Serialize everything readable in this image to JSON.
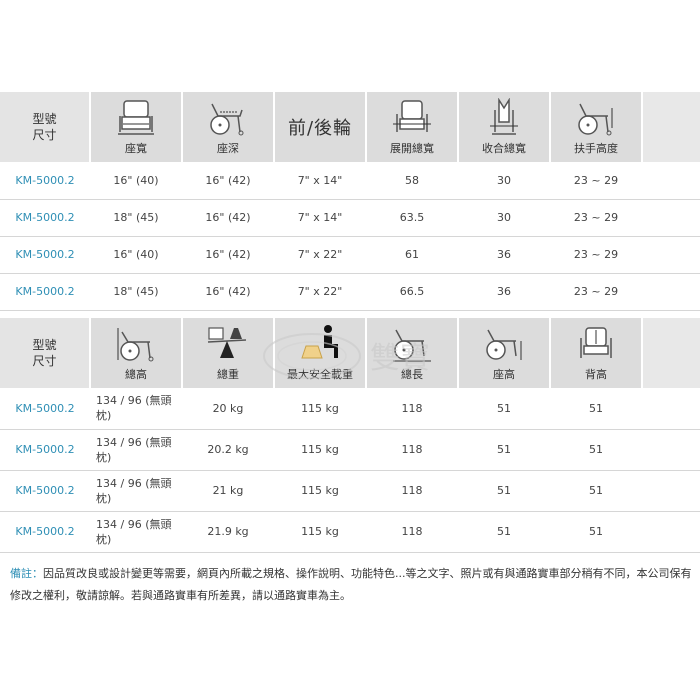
{
  "table1": {
    "model_header": [
      "型號",
      "尺寸"
    ],
    "columns": [
      "座寬",
      "座深",
      "前/後輪",
      "展開總寬",
      "收合總寬",
      "扶手高度"
    ],
    "rows": [
      {
        "model": "KM-5000.2",
        "cells": [
          "16\" (40)",
          "16\" (42)",
          "7\" x 14\"",
          "58",
          "30",
          "23 ~ 29"
        ]
      },
      {
        "model": "KM-5000.2",
        "cells": [
          "18\" (45)",
          "16\" (42)",
          "7\" x 14\"",
          "63.5",
          "30",
          "23 ~ 29"
        ]
      },
      {
        "model": "KM-5000.2",
        "cells": [
          "16\" (40)",
          "16\" (42)",
          "7\" x 22\"",
          "61",
          "36",
          "23 ~ 29"
        ]
      },
      {
        "model": "KM-5000.2",
        "cells": [
          "18\" (45)",
          "16\" (42)",
          "7\" x 22\"",
          "66.5",
          "36",
          "23 ~ 29"
        ]
      }
    ]
  },
  "table2": {
    "model_header": [
      "型號",
      "尺寸"
    ],
    "columns": [
      "總高",
      "總重",
      "最大安全載重",
      "總長",
      "座高",
      "背高"
    ],
    "rows": [
      {
        "model": "KM-5000.2",
        "cells": [
          "134 / 96 (無頭枕)",
          "20 kg",
          "115 kg",
          "118",
          "51",
          "51"
        ]
      },
      {
        "model": "KM-5000.2",
        "cells": [
          "134 / 96 (無頭枕)",
          "20.2 kg",
          "115 kg",
          "118",
          "51",
          "51"
        ]
      },
      {
        "model": "KM-5000.2",
        "cells": [
          "134 / 96 (無頭枕)",
          "21 kg",
          "115 kg",
          "118",
          "51",
          "51"
        ]
      },
      {
        "model": "KM-5000.2",
        "cells": [
          "134 / 96 (無頭枕)",
          "21.9 kg",
          "115 kg",
          "118",
          "51",
          "51"
        ]
      }
    ]
  },
  "watermark_text": "雙寶",
  "note": {
    "label": "備註：",
    "text": "因品質改良或設計變更等需要，網頁內所載之規格、操作說明、功能特色...等之文字、照片或有與通路實車部分稍有不同，本公司保有修改之權利，敬請諒解。若與通路實車有所差異，請以通路實車為主。"
  },
  "colors": {
    "header_bg": "#dcdcdc",
    "model_text": "#2f8fb5",
    "row_line": "#d6d6d6"
  },
  "icons": [
    "seat-width-icon",
    "seat-depth-icon",
    "open-width-icon",
    "folded-width-icon",
    "armrest-height-icon",
    "total-height-icon",
    "weight-scale-icon",
    "max-load-icon",
    "total-length-icon",
    "seat-height-icon",
    "back-height-icon"
  ]
}
